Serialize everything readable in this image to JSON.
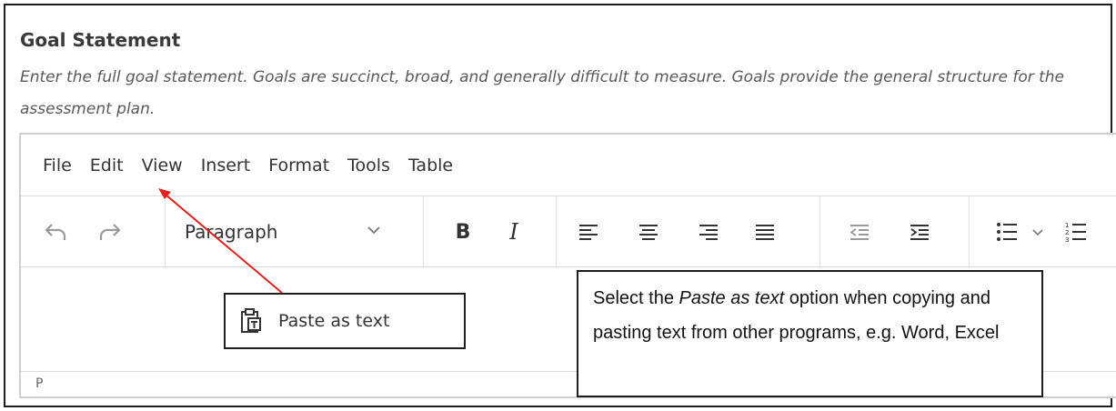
{
  "section": {
    "title": "Goal Statement",
    "help_text": "Enter the full goal statement. Goals are succinct, broad, and generally difficult to measure. Goals provide the general structure for the assessment plan."
  },
  "editor": {
    "menu": [
      "File",
      "Edit",
      "View",
      "Insert",
      "Format",
      "Tools",
      "Table"
    ],
    "toolbar": {
      "block_format": "Paragraph",
      "bold_label": "B",
      "italic_label": "I"
    },
    "statusbar_path": "P"
  },
  "callouts": {
    "paste_menu_item": "Paste as text",
    "note_prefix": "Select the ",
    "note_emphasis": "Paste as text",
    "note_suffix": " option when copying and pasting text from other programs, e.g. Word, Excel"
  },
  "colors": {
    "arrow": "#e0201b",
    "frame": "#1e1e1e",
    "icon": "#333333"
  },
  "icons": [
    "undo-icon",
    "redo-icon",
    "chevron-down-icon",
    "align-left-icon",
    "align-center-icon",
    "align-right-icon",
    "align-justify-icon",
    "outdent-icon",
    "indent-icon",
    "bullet-list-icon",
    "numbered-list-icon",
    "clipboard-text-icon"
  ]
}
